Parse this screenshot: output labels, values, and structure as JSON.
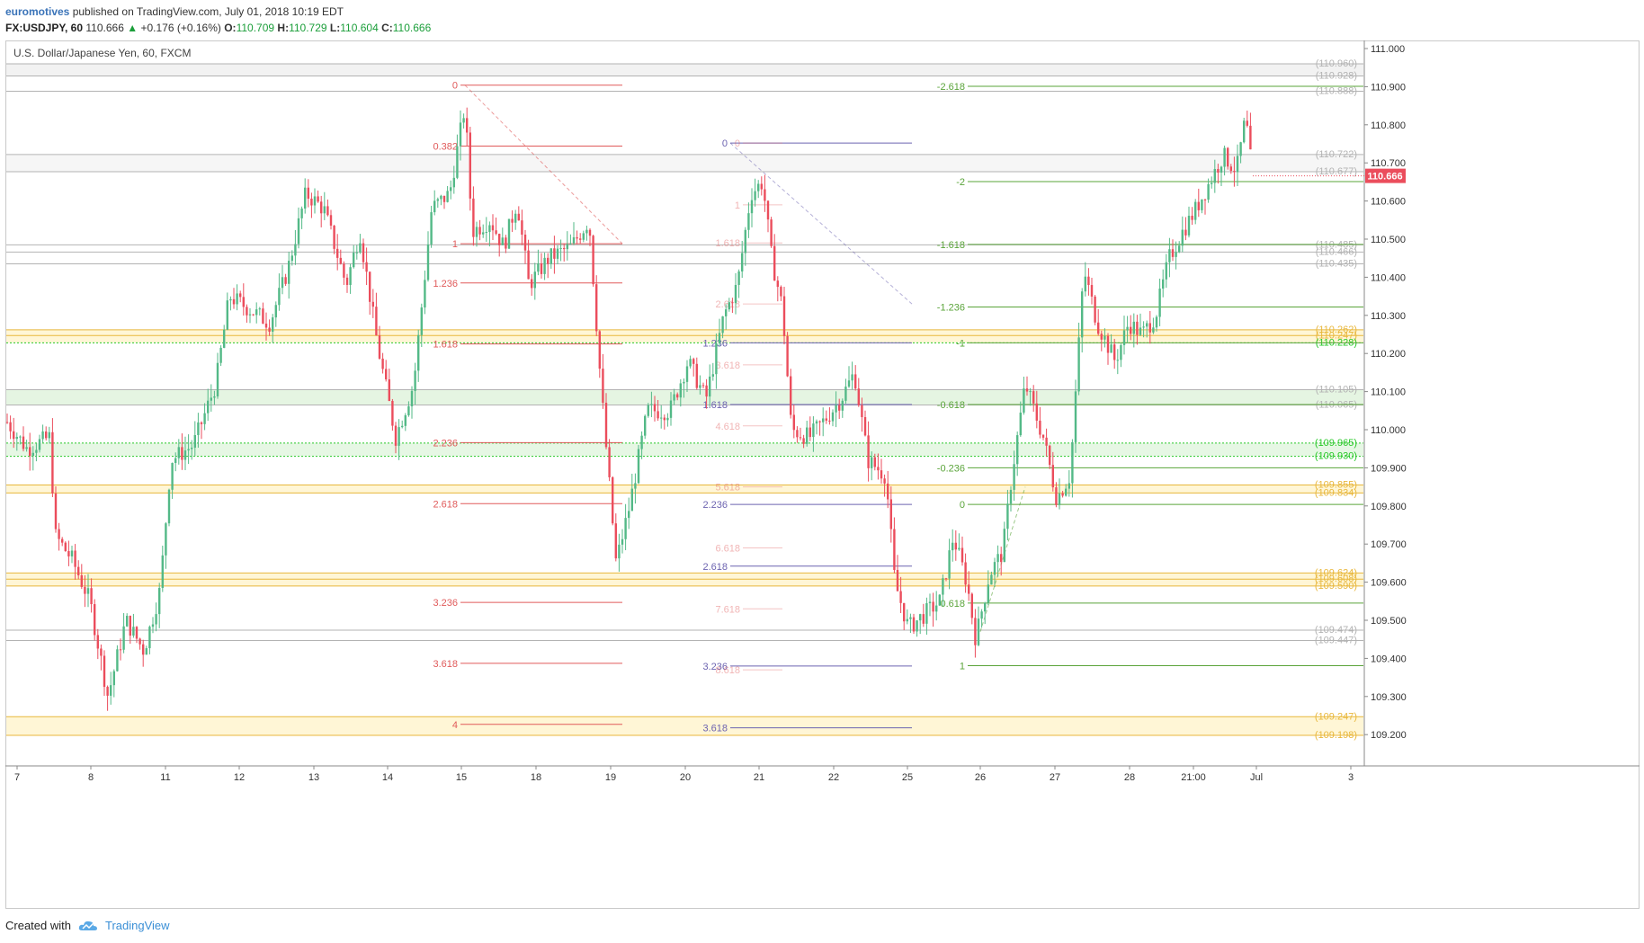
{
  "header": {
    "author": "euromotives",
    "published_text": "published on TradingView.com, July 01, 2018 10:19 EDT",
    "symbol": "FX:USDJPY, 60",
    "last": "110.666",
    "change_arrow": "▲",
    "change": "+0.176 (+0.16%)",
    "o_label": "O:",
    "o_val": "110.709",
    "h_label": "H:",
    "h_val": "110.729",
    "l_label": "L:",
    "l_val": "110.604",
    "c_label": "C:",
    "c_val": "110.666"
  },
  "chart_title": "U.S. Dollar/Japanese Yen, 60, FXCM",
  "footer": {
    "created_with": "Created with",
    "brand": "TradingView",
    "logo_icon": "tradingview-cloud-icon"
  },
  "colors": {
    "up": "#53b987",
    "down": "#eb4d5c",
    "last_bg": "#eb4d5c",
    "fib_red": "#e05a5a",
    "fib_blue": "#6c63b0",
    "fib_green": "#5aa43a",
    "gray_level": "#b3b3b3",
    "green_level": "#28c828",
    "yellow_level": "#e8b73c"
  },
  "chart_data": {
    "type": "candlestick",
    "ylim": [
      109.13,
      111.04
    ],
    "y_ticks": [
      "111.000",
      "110.900",
      "110.800",
      "110.700",
      "110.600",
      "110.500",
      "110.400",
      "110.300",
      "110.200",
      "110.100",
      "110.000",
      "109.900",
      "109.800",
      "109.700",
      "109.600",
      "109.500",
      "109.400",
      "109.300",
      "109.200"
    ],
    "x_ticks": [
      "7",
      "8",
      "11",
      "12",
      "13",
      "14",
      "15",
      "18",
      "19",
      "20",
      "21",
      "22",
      "25",
      "26",
      "27",
      "28",
      "21:00",
      "Jul",
      "3"
    ],
    "last_price": "110.666",
    "price_levels": [
      {
        "label": "(110.960)",
        "value": 110.96,
        "kind": "gray"
      },
      {
        "label": "(110.928)",
        "value": 110.928,
        "kind": "gray"
      },
      {
        "label": "(110.888)",
        "value": 110.888,
        "kind": "gray"
      },
      {
        "label": "(110.722)",
        "value": 110.722,
        "kind": "gray"
      },
      {
        "label": "(110.677)",
        "value": 110.677,
        "kind": "gray"
      },
      {
        "label": "(110.485)",
        "value": 110.485,
        "kind": "gray"
      },
      {
        "label": "(110.466)",
        "value": 110.466,
        "kind": "gray"
      },
      {
        "label": "(110.435)",
        "value": 110.435,
        "kind": "gray"
      },
      {
        "label": "(110.262)",
        "value": 110.262,
        "kind": "yellow"
      },
      {
        "label": "(110.247)",
        "value": 110.247,
        "kind": "yellow"
      },
      {
        "label": "(110.228)",
        "value": 110.228,
        "kind": "green"
      },
      {
        "label": "(110.105)",
        "value": 110.105,
        "kind": "gray"
      },
      {
        "label": "(110.065)",
        "value": 110.065,
        "kind": "gray"
      },
      {
        "label": "(109.965)",
        "value": 109.965,
        "kind": "green"
      },
      {
        "label": "(109.930)",
        "value": 109.93,
        "kind": "green"
      },
      {
        "label": "(109.855)",
        "value": 109.855,
        "kind": "yellow"
      },
      {
        "label": "(109.834)",
        "value": 109.834,
        "kind": "yellow"
      },
      {
        "label": "(109.624)",
        "value": 109.624,
        "kind": "yellow"
      },
      {
        "label": "(109.608)",
        "value": 109.608,
        "kind": "yellow"
      },
      {
        "label": "(109.590)",
        "value": 109.59,
        "kind": "yellow"
      },
      {
        "label": "(109.474)",
        "value": 109.474,
        "kind": "gray"
      },
      {
        "label": "(109.447)",
        "value": 109.447,
        "kind": "gray"
      },
      {
        "label": "(109.247)",
        "value": 109.247,
        "kind": "yellow"
      },
      {
        "label": "(109.198)",
        "value": 109.198,
        "kind": "yellow"
      }
    ],
    "fib_red": [
      {
        "label": "0",
        "value": 110.904
      },
      {
        "label": "0.382",
        "value": 110.744
      },
      {
        "label": "1",
        "value": 110.488
      },
      {
        "label": "1.236",
        "value": 110.385
      },
      {
        "label": "1.618",
        "value": 110.225
      },
      {
        "label": "2.236",
        "value": 109.966
      },
      {
        "label": "2.618",
        "value": 109.806
      },
      {
        "label": "3.236",
        "value": 109.547
      },
      {
        "label": "3.618",
        "value": 109.387
      },
      {
        "label": "4",
        "value": 109.227
      }
    ],
    "fib_blue": [
      {
        "label": "0",
        "value": 110.752
      },
      {
        "label": "1.236",
        "value": 110.228
      },
      {
        "label": "1.618",
        "value": 110.066
      },
      {
        "label": "2.236",
        "value": 109.804
      },
      {
        "label": "2.618",
        "value": 109.642
      },
      {
        "label": "3.236",
        "value": 109.38
      },
      {
        "label": "3.618",
        "value": 109.218
      }
    ],
    "fib_blue_ext": [
      {
        "label": "0",
        "value": 110.752
      },
      {
        "label": "1",
        "value": 110.59
      },
      {
        "label": "1.618",
        "value": 110.49
      },
      {
        "label": "2.618",
        "value": 110.33
      },
      {
        "label": "3.618",
        "value": 110.17
      },
      {
        "label": "4.618",
        "value": 110.01
      },
      {
        "label": "5.618",
        "value": 109.85
      },
      {
        "label": "6.618",
        "value": 109.69
      },
      {
        "label": "7.618",
        "value": 109.53
      },
      {
        "label": "8.618",
        "value": 109.37
      }
    ],
    "fib_green": [
      {
        "label": "-2.618",
        "value": 110.901
      },
      {
        "label": "-2",
        "value": 110.651
      },
      {
        "label": "-1.618",
        "value": 110.486
      },
      {
        "label": "-1.236",
        "value": 110.322
      },
      {
        "label": "-1",
        "value": 110.228
      },
      {
        "label": "-0.618",
        "value": 110.066
      },
      {
        "label": "-0.236",
        "value": 109.9
      },
      {
        "label": "0",
        "value": 109.804
      },
      {
        "label": "0.618",
        "value": 109.545
      },
      {
        "label": "1",
        "value": 109.381
      }
    ]
  }
}
